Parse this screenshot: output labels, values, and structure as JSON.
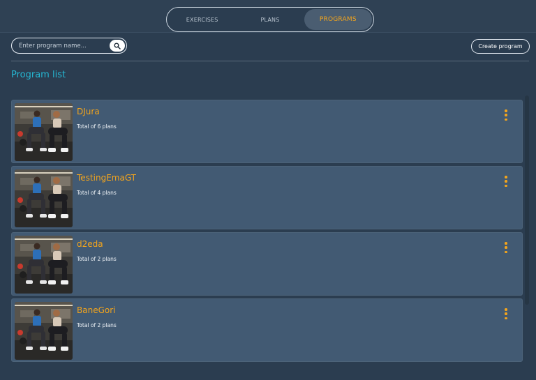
{
  "nav": {
    "tabs": [
      {
        "label": "EXERCISES",
        "active": false
      },
      {
        "label": "PLANS",
        "active": false
      },
      {
        "label": "PROGRAMS",
        "active": true
      }
    ]
  },
  "toolbar": {
    "search_placeholder": "Enter program name...",
    "search_value": "",
    "search_icon": "search-icon",
    "create_label": "Create program"
  },
  "main": {
    "title": "Program list",
    "programs": [
      {
        "name": "DJura",
        "summary": "Total of 6 plans",
        "image": "workout-squat-photo"
      },
      {
        "name": "TestingEmaGT",
        "summary": "Total of 4 plans",
        "image": "workout-squat-photo"
      },
      {
        "name": "d2eda",
        "summary": "Total of 2 plans",
        "image": "workout-squat-photo"
      },
      {
        "name": "BaneGori",
        "summary": "Total of 2 plans",
        "image": "workout-squat-photo"
      }
    ]
  },
  "colors": {
    "accent": "#f4a51c",
    "title": "#25b7d3",
    "background": "#2b3d50",
    "card": "#425a73"
  }
}
